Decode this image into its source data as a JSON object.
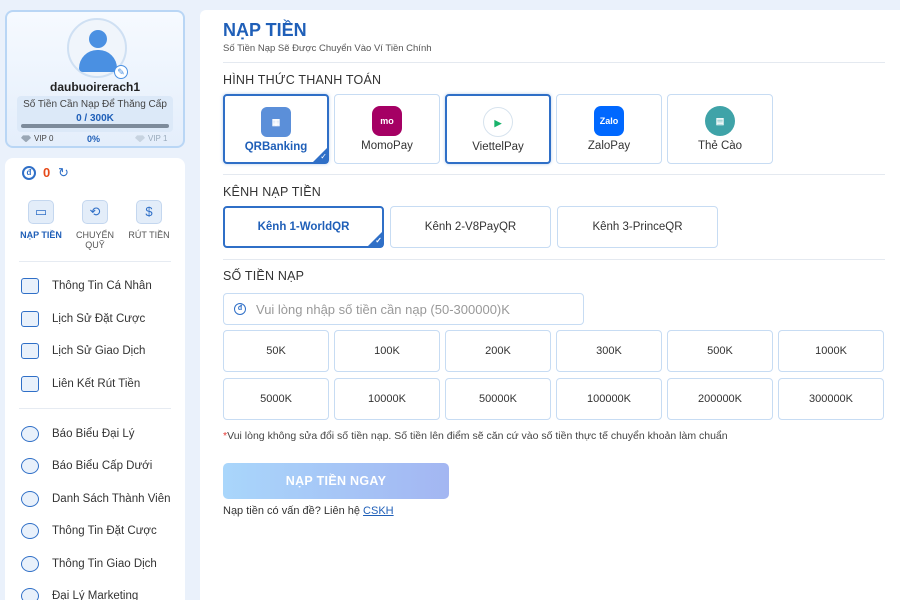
{
  "profile": {
    "username": "daubuoirerach1",
    "upgrade_label": "Số Tiền Cần Nạp Để Thăng Cấp",
    "upgrade_amount": "0 / 300K",
    "vip_current": "VIP 0",
    "vip_progress": "0%",
    "vip_next": "VIP 1",
    "vip_progress_value": 0
  },
  "wallet": {
    "balance": "0"
  },
  "quick_actions": [
    {
      "label": "NẠP TIỀN",
      "icon": "wallet-icon",
      "active": true
    },
    {
      "label": "CHUYỂN QUỸ",
      "icon": "transfer-icon",
      "active": false
    },
    {
      "label": "RÚT TIỀN",
      "icon": "money-bag-icon",
      "active": false
    }
  ],
  "menu_group1": [
    {
      "label": "Thông Tin Cá Nhân",
      "icon": "id-card-icon"
    },
    {
      "label": "Lịch Sử Đặt Cược",
      "icon": "bet-history-icon"
    },
    {
      "label": "Lịch Sử Giao Dịch",
      "icon": "transaction-history-icon"
    },
    {
      "label": "Liên Kết Rút Tiền",
      "icon": "link-card-icon"
    }
  ],
  "menu_group2": [
    {
      "label": "Báo Biểu Đại Lý",
      "icon": "agent-report-icon"
    },
    {
      "label": "Báo Biểu Cấp Dưới",
      "icon": "sub-report-icon"
    },
    {
      "label": "Danh Sách Thành Viên",
      "icon": "member-list-icon"
    },
    {
      "label": "Thông Tin Đặt Cược",
      "icon": "bet-info-icon"
    },
    {
      "label": "Thông Tin Giao Dịch",
      "icon": "transaction-info-icon"
    },
    {
      "label": "Đại Lý Marketing",
      "icon": "marketing-icon"
    }
  ],
  "header": {
    "title": "NẠP TIỀN",
    "subtitle": "Số Tiền Nạp Sẽ Được Chuyển Vào Ví Tiền Chính"
  },
  "payment": {
    "section_label": "HÌNH THỨC THANH TOÁN",
    "methods": [
      {
        "label": "QRBanking",
        "icon": "qr-code-icon",
        "color": "#5b8fd9",
        "selected": true
      },
      {
        "label": "MomoPay",
        "icon": "momo-icon",
        "color": "#a50064",
        "selected": false
      },
      {
        "label": "ViettelPay",
        "icon": "viettelpay-icon",
        "color": "#ffffff",
        "selected": false
      },
      {
        "label": "ZaloPay",
        "icon": "zalopay-icon",
        "color": "#0068ff",
        "selected": false
      },
      {
        "label": "Thẻ Cào",
        "icon": "scratch-card-icon",
        "color": "#3fa3a8",
        "selected": false
      }
    ]
  },
  "channel": {
    "section_label": "KÊNH NẠP TIỀN",
    "options": [
      {
        "label": "Kênh 1-WorldQR",
        "selected": true
      },
      {
        "label": "Kênh 2-V8PayQR",
        "selected": false
      },
      {
        "label": "Kênh 3-PrinceQR",
        "selected": false
      }
    ]
  },
  "amount": {
    "section_label": "SỐ TIỀN NẠP",
    "placeholder": "Vui lòng nhập số tiền cần nạp (50-300000)K",
    "presets": [
      "50K",
      "100K",
      "200K",
      "300K",
      "500K",
      "1000K",
      "5000K",
      "10000K",
      "50000K",
      "100000K",
      "200000K",
      "300000K"
    ]
  },
  "note": {
    "star": "*",
    "text": "Vui lòng không sửa đổi số tiền nạp. Số tiền lên điểm sẽ căn cứ vào số tiền thực tế chuyển khoản làm chuẩn"
  },
  "submit_label": "NẠP TIỀN NGAY",
  "help": {
    "text": "Nạp tiền có vấn đề? Liên hệ ",
    "link": "CSKH"
  },
  "colors": {
    "accent": "#1f5fb8",
    "balance": "#e64a19",
    "border": "#c7dcf3"
  }
}
